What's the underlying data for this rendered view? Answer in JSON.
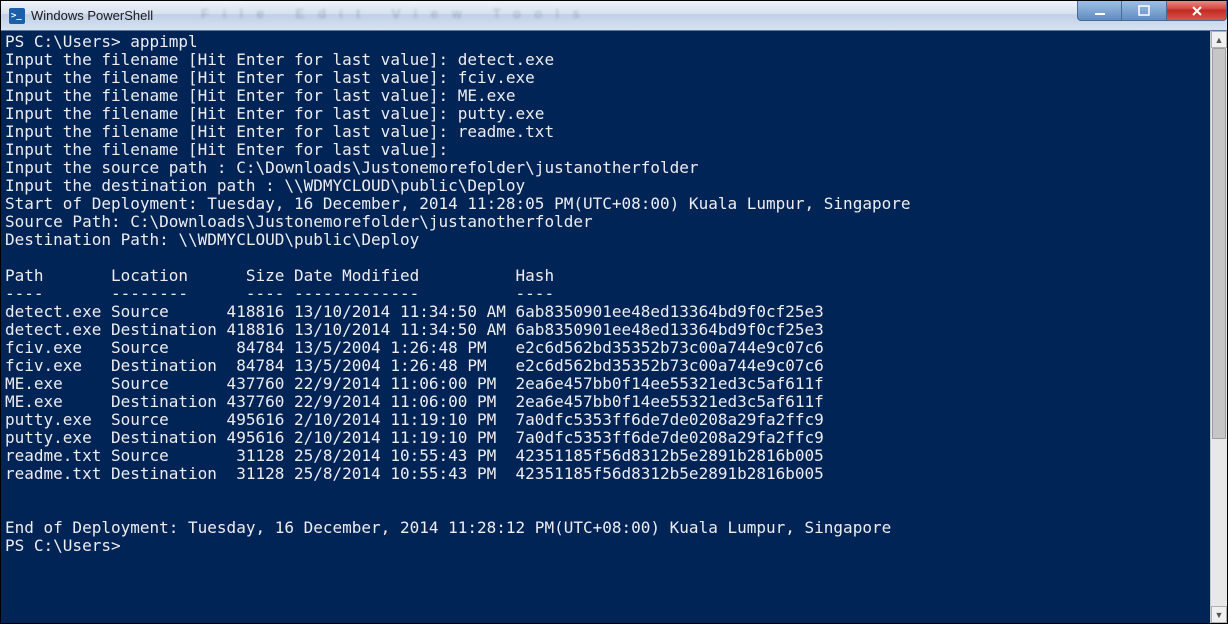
{
  "window": {
    "title": "Windows PowerShell"
  },
  "prompt1": "PS C:\\Users> appimpl",
  "inputs": [
    "Input the filename [Hit Enter for last value]: detect.exe",
    "Input the filename [Hit Enter for last value]: fciv.exe",
    "Input the filename [Hit Enter for last value]: ME.exe",
    "Input the filename [Hit Enter for last value]: putty.exe",
    "Input the filename [Hit Enter for last value]: readme.txt",
    "Input the filename [Hit Enter for last value]:",
    "Input the source path : C:\\Downloads\\Justonemorefolder\\justanotherfolder",
    "Input the destination path : \\\\WDMYCLOUD\\public\\Deploy"
  ],
  "start_line": "Start of Deployment: Tuesday, 16 December, 2014 11:28:05 PM(UTC+08:00) Kuala Lumpur, Singapore",
  "source_line": "Source Path: C:\\Downloads\\Justonemorefolder\\justanotherfolder",
  "dest_line": "Destination Path: \\\\WDMYCLOUD\\public\\Deploy",
  "table": {
    "headers": [
      "Path",
      "Location",
      "Size",
      "Date Modified",
      "Hash"
    ],
    "rows": [
      {
        "path": "detect.exe",
        "loc": "Source",
        "size": "418816",
        "date": "13/10/2014 11:34:50 AM",
        "hash": "6ab8350901ee48ed13364bd9f0cf25e3"
      },
      {
        "path": "detect.exe",
        "loc": "Destination",
        "size": "418816",
        "date": "13/10/2014 11:34:50 AM",
        "hash": "6ab8350901ee48ed13364bd9f0cf25e3"
      },
      {
        "path": "fciv.exe",
        "loc": "Source",
        "size": "84784",
        "date": "13/5/2004 1:26:48 PM",
        "hash": "e2c6d562bd35352b73c00a744e9c07c6"
      },
      {
        "path": "fciv.exe",
        "loc": "Destination",
        "size": "84784",
        "date": "13/5/2004 1:26:48 PM",
        "hash": "e2c6d562bd35352b73c00a744e9c07c6"
      },
      {
        "path": "ME.exe",
        "loc": "Source",
        "size": "437760",
        "date": "22/9/2014 11:06:00 PM",
        "hash": "2ea6e457bb0f14ee55321ed3c5af611f"
      },
      {
        "path": "ME.exe",
        "loc": "Destination",
        "size": "437760",
        "date": "22/9/2014 11:06:00 PM",
        "hash": "2ea6e457bb0f14ee55321ed3c5af611f"
      },
      {
        "path": "putty.exe",
        "loc": "Source",
        "size": "495616",
        "date": "2/10/2014 11:19:10 PM",
        "hash": "7a0dfc5353ff6de7de0208a29fa2ffc9"
      },
      {
        "path": "putty.exe",
        "loc": "Destination",
        "size": "495616",
        "date": "2/10/2014 11:19:10 PM",
        "hash": "7a0dfc5353ff6de7de0208a29fa2ffc9"
      },
      {
        "path": "readme.txt",
        "loc": "Source",
        "size": "31128",
        "date": "25/8/2014 10:55:43 PM",
        "hash": "42351185f56d8312b5e2891b2816b005"
      },
      {
        "path": "readme.txt",
        "loc": "Destination",
        "size": "31128",
        "date": "25/8/2014 10:55:43 PM",
        "hash": "42351185f56d8312b5e2891b2816b005"
      }
    ]
  },
  "end_line": "End of Deployment: Tuesday, 16 December, 2014 11:28:12 PM(UTC+08:00) Kuala Lumpur, Singapore",
  "prompt2": "PS C:\\Users>",
  "col_widths": {
    "path": 11,
    "loc": 12,
    "size": 6,
    "date": 23
  }
}
